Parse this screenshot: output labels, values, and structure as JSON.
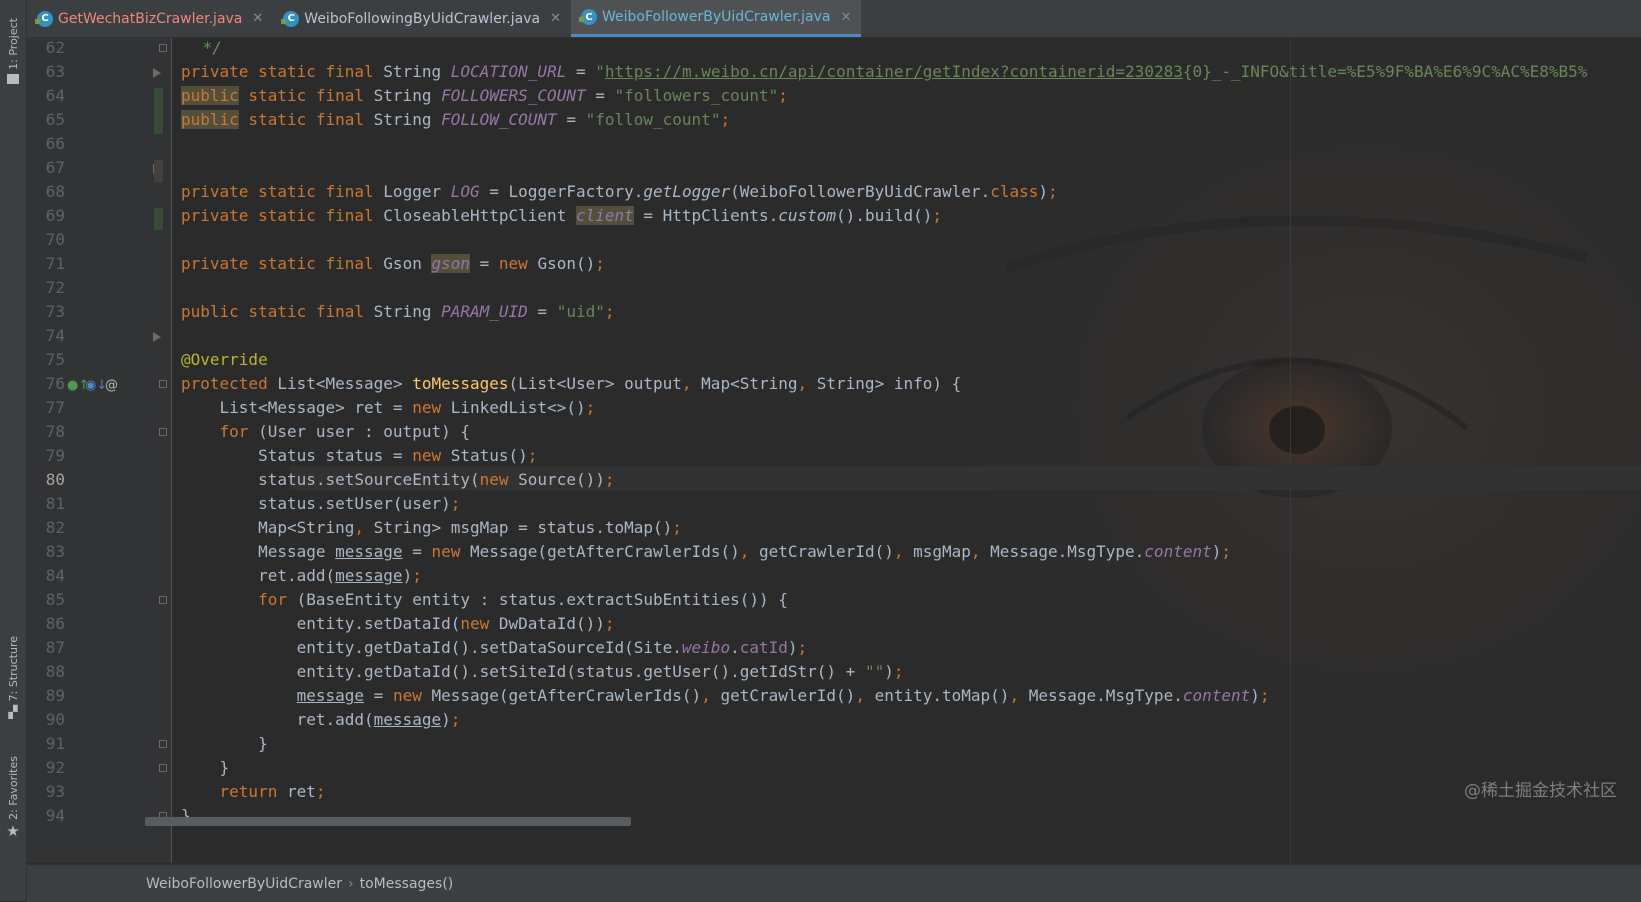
{
  "sidebar": {
    "top_tab": "1: Project",
    "structure_tab": "7: Structure",
    "favorites_tab": "2: Favorites"
  },
  "tabs": [
    {
      "label": "GetWechatBizCrawler.java",
      "color": "#f0867e",
      "active": false
    },
    {
      "label": "WeiboFollowingByUidCrawler.java",
      "color": "#b9c5d1",
      "active": false
    },
    {
      "label": "WeiboFollowerByUidCrawler.java",
      "color": "#6ab7d8",
      "active": true
    }
  ],
  "editor": {
    "current_line": 80,
    "line_numbers": [
      62,
      63,
      64,
      65,
      66,
      67,
      68,
      69,
      70,
      71,
      72,
      73,
      74,
      75,
      76,
      77,
      78,
      79,
      80,
      81,
      82,
      83,
      84,
      85,
      86,
      87,
      88,
      89,
      90,
      91,
      92,
      93,
      94
    ],
    "lines": {
      "l62_cmt": " */",
      "l63_url": "https://m.weibo.cn/api/container/getIndex?containerid=230283",
      "l63_rest": "{0}_-_INFO&title=%E5%9F%BA%E6%9C%AC%E8%B5%",
      "l64_str": "\"followers_count\"",
      "l65_str": "\"follow_count\"",
      "l73_str": "\"uid\"",
      "l88_str": "\"\""
    }
  },
  "breadcrumbs": {
    "class_name": "WeiboFollowerByUidCrawler",
    "method_name": "toMessages()"
  },
  "watermark": "@稀土掘金技术社区",
  "colors": {
    "keyword": "#cc7832",
    "string": "#6a8759",
    "field": "#9876aa",
    "method": "#ffc66d",
    "annotation": "#bbb529",
    "text": "#a9b7c6"
  }
}
